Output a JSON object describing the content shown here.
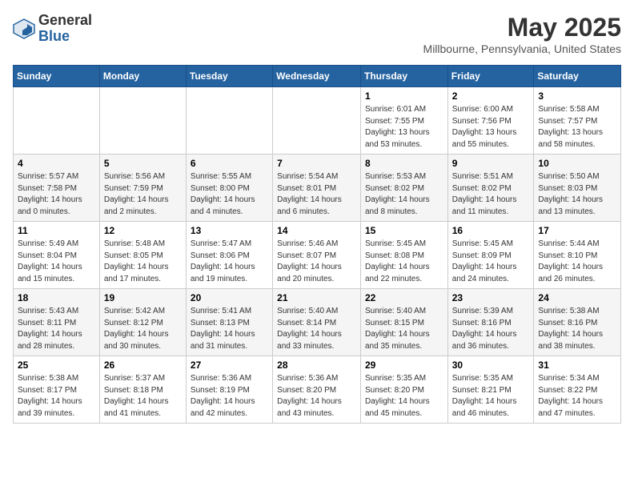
{
  "header": {
    "logo": {
      "general": "General",
      "blue": "Blue"
    },
    "title": "May 2025",
    "subtitle": "Millbourne, Pennsylvania, United States"
  },
  "columns": [
    "Sunday",
    "Monday",
    "Tuesday",
    "Wednesday",
    "Thursday",
    "Friday",
    "Saturday"
  ],
  "weeks": [
    [
      {
        "num": "",
        "info": ""
      },
      {
        "num": "",
        "info": ""
      },
      {
        "num": "",
        "info": ""
      },
      {
        "num": "",
        "info": ""
      },
      {
        "num": "1",
        "info": "Sunrise: 6:01 AM\nSunset: 7:55 PM\nDaylight: 13 hours\nand 53 minutes."
      },
      {
        "num": "2",
        "info": "Sunrise: 6:00 AM\nSunset: 7:56 PM\nDaylight: 13 hours\nand 55 minutes."
      },
      {
        "num": "3",
        "info": "Sunrise: 5:58 AM\nSunset: 7:57 PM\nDaylight: 13 hours\nand 58 minutes."
      }
    ],
    [
      {
        "num": "4",
        "info": "Sunrise: 5:57 AM\nSunset: 7:58 PM\nDaylight: 14 hours\nand 0 minutes."
      },
      {
        "num": "5",
        "info": "Sunrise: 5:56 AM\nSunset: 7:59 PM\nDaylight: 14 hours\nand 2 minutes."
      },
      {
        "num": "6",
        "info": "Sunrise: 5:55 AM\nSunset: 8:00 PM\nDaylight: 14 hours\nand 4 minutes."
      },
      {
        "num": "7",
        "info": "Sunrise: 5:54 AM\nSunset: 8:01 PM\nDaylight: 14 hours\nand 6 minutes."
      },
      {
        "num": "8",
        "info": "Sunrise: 5:53 AM\nSunset: 8:02 PM\nDaylight: 14 hours\nand 8 minutes."
      },
      {
        "num": "9",
        "info": "Sunrise: 5:51 AM\nSunset: 8:02 PM\nDaylight: 14 hours\nand 11 minutes."
      },
      {
        "num": "10",
        "info": "Sunrise: 5:50 AM\nSunset: 8:03 PM\nDaylight: 14 hours\nand 13 minutes."
      }
    ],
    [
      {
        "num": "11",
        "info": "Sunrise: 5:49 AM\nSunset: 8:04 PM\nDaylight: 14 hours\nand 15 minutes."
      },
      {
        "num": "12",
        "info": "Sunrise: 5:48 AM\nSunset: 8:05 PM\nDaylight: 14 hours\nand 17 minutes."
      },
      {
        "num": "13",
        "info": "Sunrise: 5:47 AM\nSunset: 8:06 PM\nDaylight: 14 hours\nand 19 minutes."
      },
      {
        "num": "14",
        "info": "Sunrise: 5:46 AM\nSunset: 8:07 PM\nDaylight: 14 hours\nand 20 minutes."
      },
      {
        "num": "15",
        "info": "Sunrise: 5:45 AM\nSunset: 8:08 PM\nDaylight: 14 hours\nand 22 minutes."
      },
      {
        "num": "16",
        "info": "Sunrise: 5:45 AM\nSunset: 8:09 PM\nDaylight: 14 hours\nand 24 minutes."
      },
      {
        "num": "17",
        "info": "Sunrise: 5:44 AM\nSunset: 8:10 PM\nDaylight: 14 hours\nand 26 minutes."
      }
    ],
    [
      {
        "num": "18",
        "info": "Sunrise: 5:43 AM\nSunset: 8:11 PM\nDaylight: 14 hours\nand 28 minutes."
      },
      {
        "num": "19",
        "info": "Sunrise: 5:42 AM\nSunset: 8:12 PM\nDaylight: 14 hours\nand 30 minutes."
      },
      {
        "num": "20",
        "info": "Sunrise: 5:41 AM\nSunset: 8:13 PM\nDaylight: 14 hours\nand 31 minutes."
      },
      {
        "num": "21",
        "info": "Sunrise: 5:40 AM\nSunset: 8:14 PM\nDaylight: 14 hours\nand 33 minutes."
      },
      {
        "num": "22",
        "info": "Sunrise: 5:40 AM\nSunset: 8:15 PM\nDaylight: 14 hours\nand 35 minutes."
      },
      {
        "num": "23",
        "info": "Sunrise: 5:39 AM\nSunset: 8:16 PM\nDaylight: 14 hours\nand 36 minutes."
      },
      {
        "num": "24",
        "info": "Sunrise: 5:38 AM\nSunset: 8:16 PM\nDaylight: 14 hours\nand 38 minutes."
      }
    ],
    [
      {
        "num": "25",
        "info": "Sunrise: 5:38 AM\nSunset: 8:17 PM\nDaylight: 14 hours\nand 39 minutes."
      },
      {
        "num": "26",
        "info": "Sunrise: 5:37 AM\nSunset: 8:18 PM\nDaylight: 14 hours\nand 41 minutes."
      },
      {
        "num": "27",
        "info": "Sunrise: 5:36 AM\nSunset: 8:19 PM\nDaylight: 14 hours\nand 42 minutes."
      },
      {
        "num": "28",
        "info": "Sunrise: 5:36 AM\nSunset: 8:20 PM\nDaylight: 14 hours\nand 43 minutes."
      },
      {
        "num": "29",
        "info": "Sunrise: 5:35 AM\nSunset: 8:20 PM\nDaylight: 14 hours\nand 45 minutes."
      },
      {
        "num": "30",
        "info": "Sunrise: 5:35 AM\nSunset: 8:21 PM\nDaylight: 14 hours\nand 46 minutes."
      },
      {
        "num": "31",
        "info": "Sunrise: 5:34 AM\nSunset: 8:22 PM\nDaylight: 14 hours\nand 47 minutes."
      }
    ]
  ]
}
